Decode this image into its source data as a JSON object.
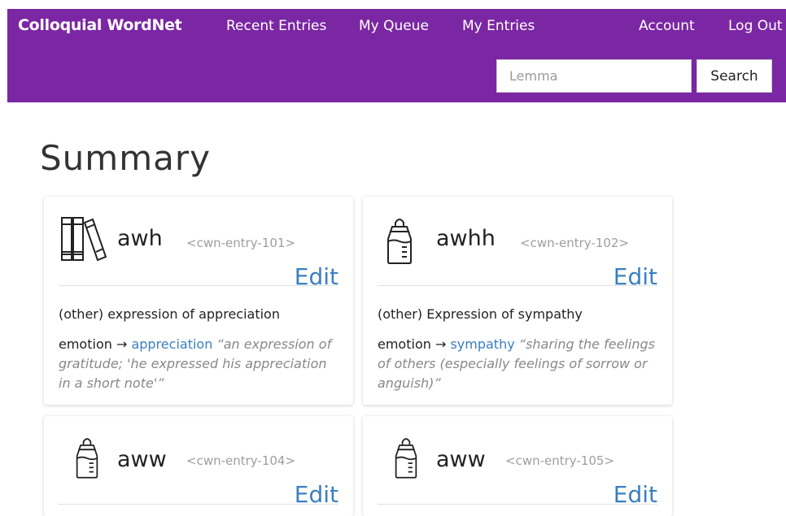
{
  "header": {
    "brand": "Colloquial WordNet",
    "nav": [
      "Recent Entries",
      "My Queue",
      "My Entries"
    ],
    "account": "Account",
    "logout": "Log Out",
    "search_placeholder": "Lemma",
    "search_button": "Search"
  },
  "page": {
    "title": "Summary"
  },
  "cards": [
    {
      "icon": "books-icon",
      "lemma": "awh",
      "entry_id": "<cwn-entry-101>",
      "edit": "Edit",
      "gloss": "(other) expression of appreciation",
      "rel_type": "emotion →",
      "rel_target": "appreciation",
      "rel_def": "“an expression of gratitude; 'he expressed his appreciation in a short note'”"
    },
    {
      "icon": "baby-bottle-icon",
      "lemma": "awhh",
      "entry_id": "<cwn-entry-102>",
      "edit": "Edit",
      "gloss": "(other) Expression of sympathy",
      "rel_type": "emotion →",
      "rel_target": "sympathy",
      "rel_def": "“sharing the feelings of others (especially feelings of sorrow or anguish)”"
    },
    {
      "icon": "baby-bottle-icon",
      "lemma": "aww",
      "entry_id": "<cwn-entry-104>",
      "edit": "Edit"
    },
    {
      "icon": "baby-bottle-icon",
      "lemma": "aww",
      "entry_id": "<cwn-entry-105>",
      "edit": "Edit"
    }
  ]
}
